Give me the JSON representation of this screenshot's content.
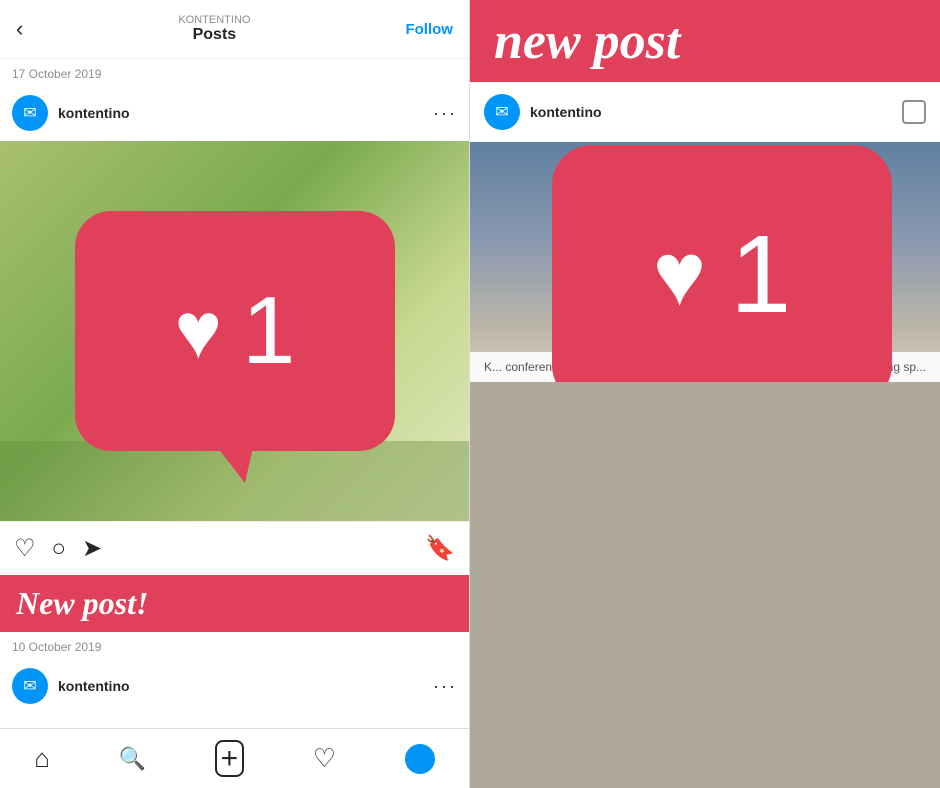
{
  "left": {
    "header": {
      "back_arrow": "‹",
      "account": "KONTENTINO",
      "posts_label": "Posts",
      "follow_label": "Follow"
    },
    "date1": "17 October 2019",
    "post1": {
      "username": "kontentino",
      "like_count": "1",
      "new_post_label": "New post!"
    },
    "date2": "10 October 2019",
    "post2": {
      "username": "kontentino"
    },
    "bottom_nav": {
      "home": "⌂",
      "search": "🔍",
      "add": "⊕",
      "heart": "♡"
    }
  },
  "right": {
    "header_text": "new post",
    "post": {
      "username": "kontentino",
      "like_count": "1",
      "caption_left": "K... conference!",
      "caption_right": "ur amazing sp..."
    }
  },
  "colors": {
    "red": "#e1405a",
    "blue": "#0095f6",
    "white": "#ffffff",
    "dark": "#262626",
    "gray": "#8e8e8e",
    "bg_right": "#b0a898"
  }
}
